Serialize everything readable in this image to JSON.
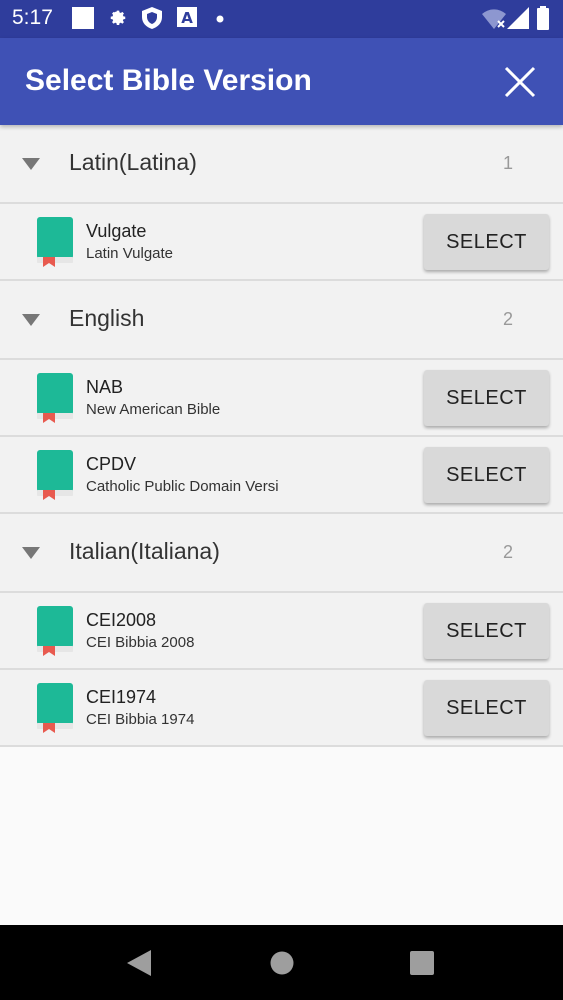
{
  "status_bar": {
    "time": "5:17",
    "icons": [
      "square-notification-icon",
      "gear-icon",
      "shield-icon",
      "font-a-icon",
      "dot-icon",
      "wifi-icon",
      "signal-icon",
      "battery-icon"
    ]
  },
  "app_bar": {
    "title": "Select Bible Version",
    "close_icon": "close-icon"
  },
  "colors": {
    "status_bar": "#2f3d9c",
    "app_bar": "#3f51b5",
    "book_icon": "#1db997",
    "bookmark": "#e85a4f"
  },
  "select_label": "SELECT",
  "groups": [
    {
      "name": "Latin(Latina)",
      "count": "1",
      "items": [
        {
          "name": "Vulgate",
          "description": "Latin Vulgate"
        }
      ]
    },
    {
      "name": "English",
      "count": "2",
      "items": [
        {
          "name": "NAB",
          "description": "New American Bible"
        },
        {
          "name": "CPDV",
          "description": "Catholic Public Domain Versi"
        }
      ]
    },
    {
      "name": "Italian(Italiana)",
      "count": "2",
      "items": [
        {
          "name": "CEI2008",
          "description": "CEI Bibbia 2008"
        },
        {
          "name": "CEI1974",
          "description": "CEI Bibbia 1974"
        }
      ]
    }
  ],
  "nav_bar": [
    "back-icon",
    "home-icon",
    "recents-icon"
  ]
}
